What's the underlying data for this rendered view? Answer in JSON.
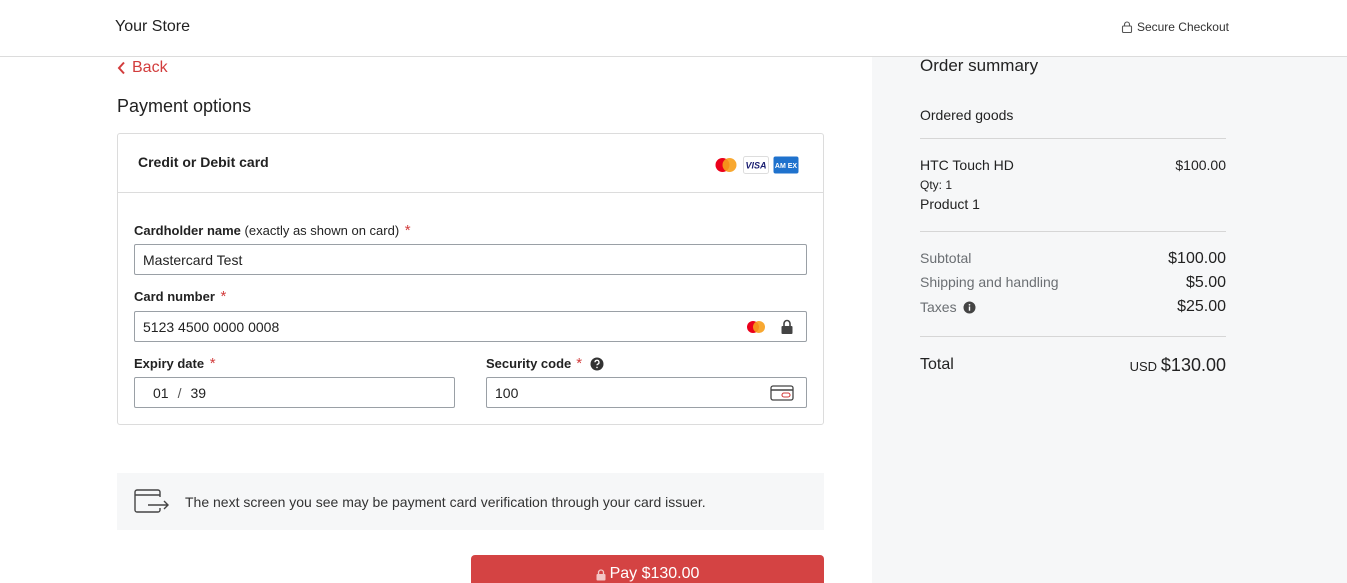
{
  "header": {
    "store_name": "Your Store",
    "secure_label": "Secure Checkout"
  },
  "nav": {
    "back_label": "Back"
  },
  "page": {
    "title": "Payment options"
  },
  "card_form": {
    "heading": "Credit or Debit card",
    "brands": [
      "mastercard-icon",
      "visa-icon",
      "amex-icon"
    ],
    "brand_visa_text": "VISA",
    "brand_amex_text": "AM EX",
    "cardholder": {
      "label": "Cardholder name",
      "hint": "(exactly as shown on card)",
      "required": "*",
      "value": "Mastercard Test"
    },
    "card_number": {
      "label": "Card number",
      "required": "*",
      "value": "5123 4500 0000 0008"
    },
    "expiry": {
      "label": "Expiry date",
      "required": "*",
      "month": "01",
      "separator": "/",
      "year": "39"
    },
    "security": {
      "label": "Security code",
      "required": "*",
      "value": "100"
    }
  },
  "notice": {
    "text": "The next screen you see may be payment card verification through your card issuer."
  },
  "pay_button": {
    "label": "Pay $130.00"
  },
  "summary": {
    "title": "Order summary",
    "section": "Ordered goods",
    "item": {
      "name": "HTC Touch HD",
      "qty": "Qty: 1",
      "variant": "Product 1",
      "price": "$100.00"
    },
    "subtotal": {
      "label": "Subtotal",
      "value": "$100.00"
    },
    "shipping": {
      "label": "Shipping and handling",
      "value": "$5.00"
    },
    "taxes": {
      "label": "Taxes",
      "value": "$25.00"
    },
    "total": {
      "label": "Total",
      "currency": "USD",
      "value": "$130.00"
    }
  },
  "colors": {
    "accent": "#d44343",
    "link": "#d23c3c",
    "panel_bg": "#f6f7f8"
  }
}
